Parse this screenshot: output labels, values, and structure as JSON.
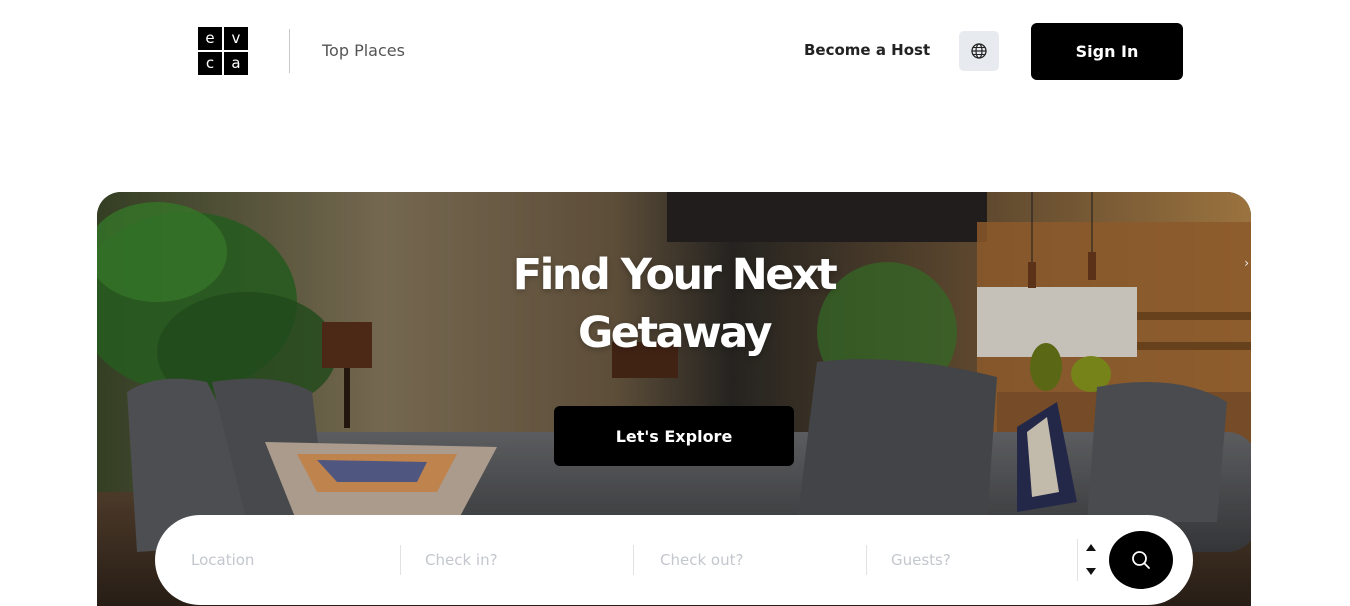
{
  "header": {
    "logo_letters": [
      "e",
      "v",
      "c",
      "a"
    ],
    "top_places": "Top Places",
    "become_host": "Become a Host",
    "language_icon": "globe-icon",
    "sign_in": "Sign In"
  },
  "hero": {
    "title_line1": "Find Your Next",
    "title_line2": "Getaway",
    "explore_button": "Let's Explore"
  },
  "search": {
    "location_placeholder": "Location",
    "checkin_placeholder": "Check in?",
    "checkout_placeholder": "Check out?",
    "guests_placeholder": "Guests?",
    "search_icon": "search-icon"
  },
  "colors": {
    "primary": "#000000",
    "background": "#ffffff",
    "globe_button_bg": "#e7ebef"
  }
}
